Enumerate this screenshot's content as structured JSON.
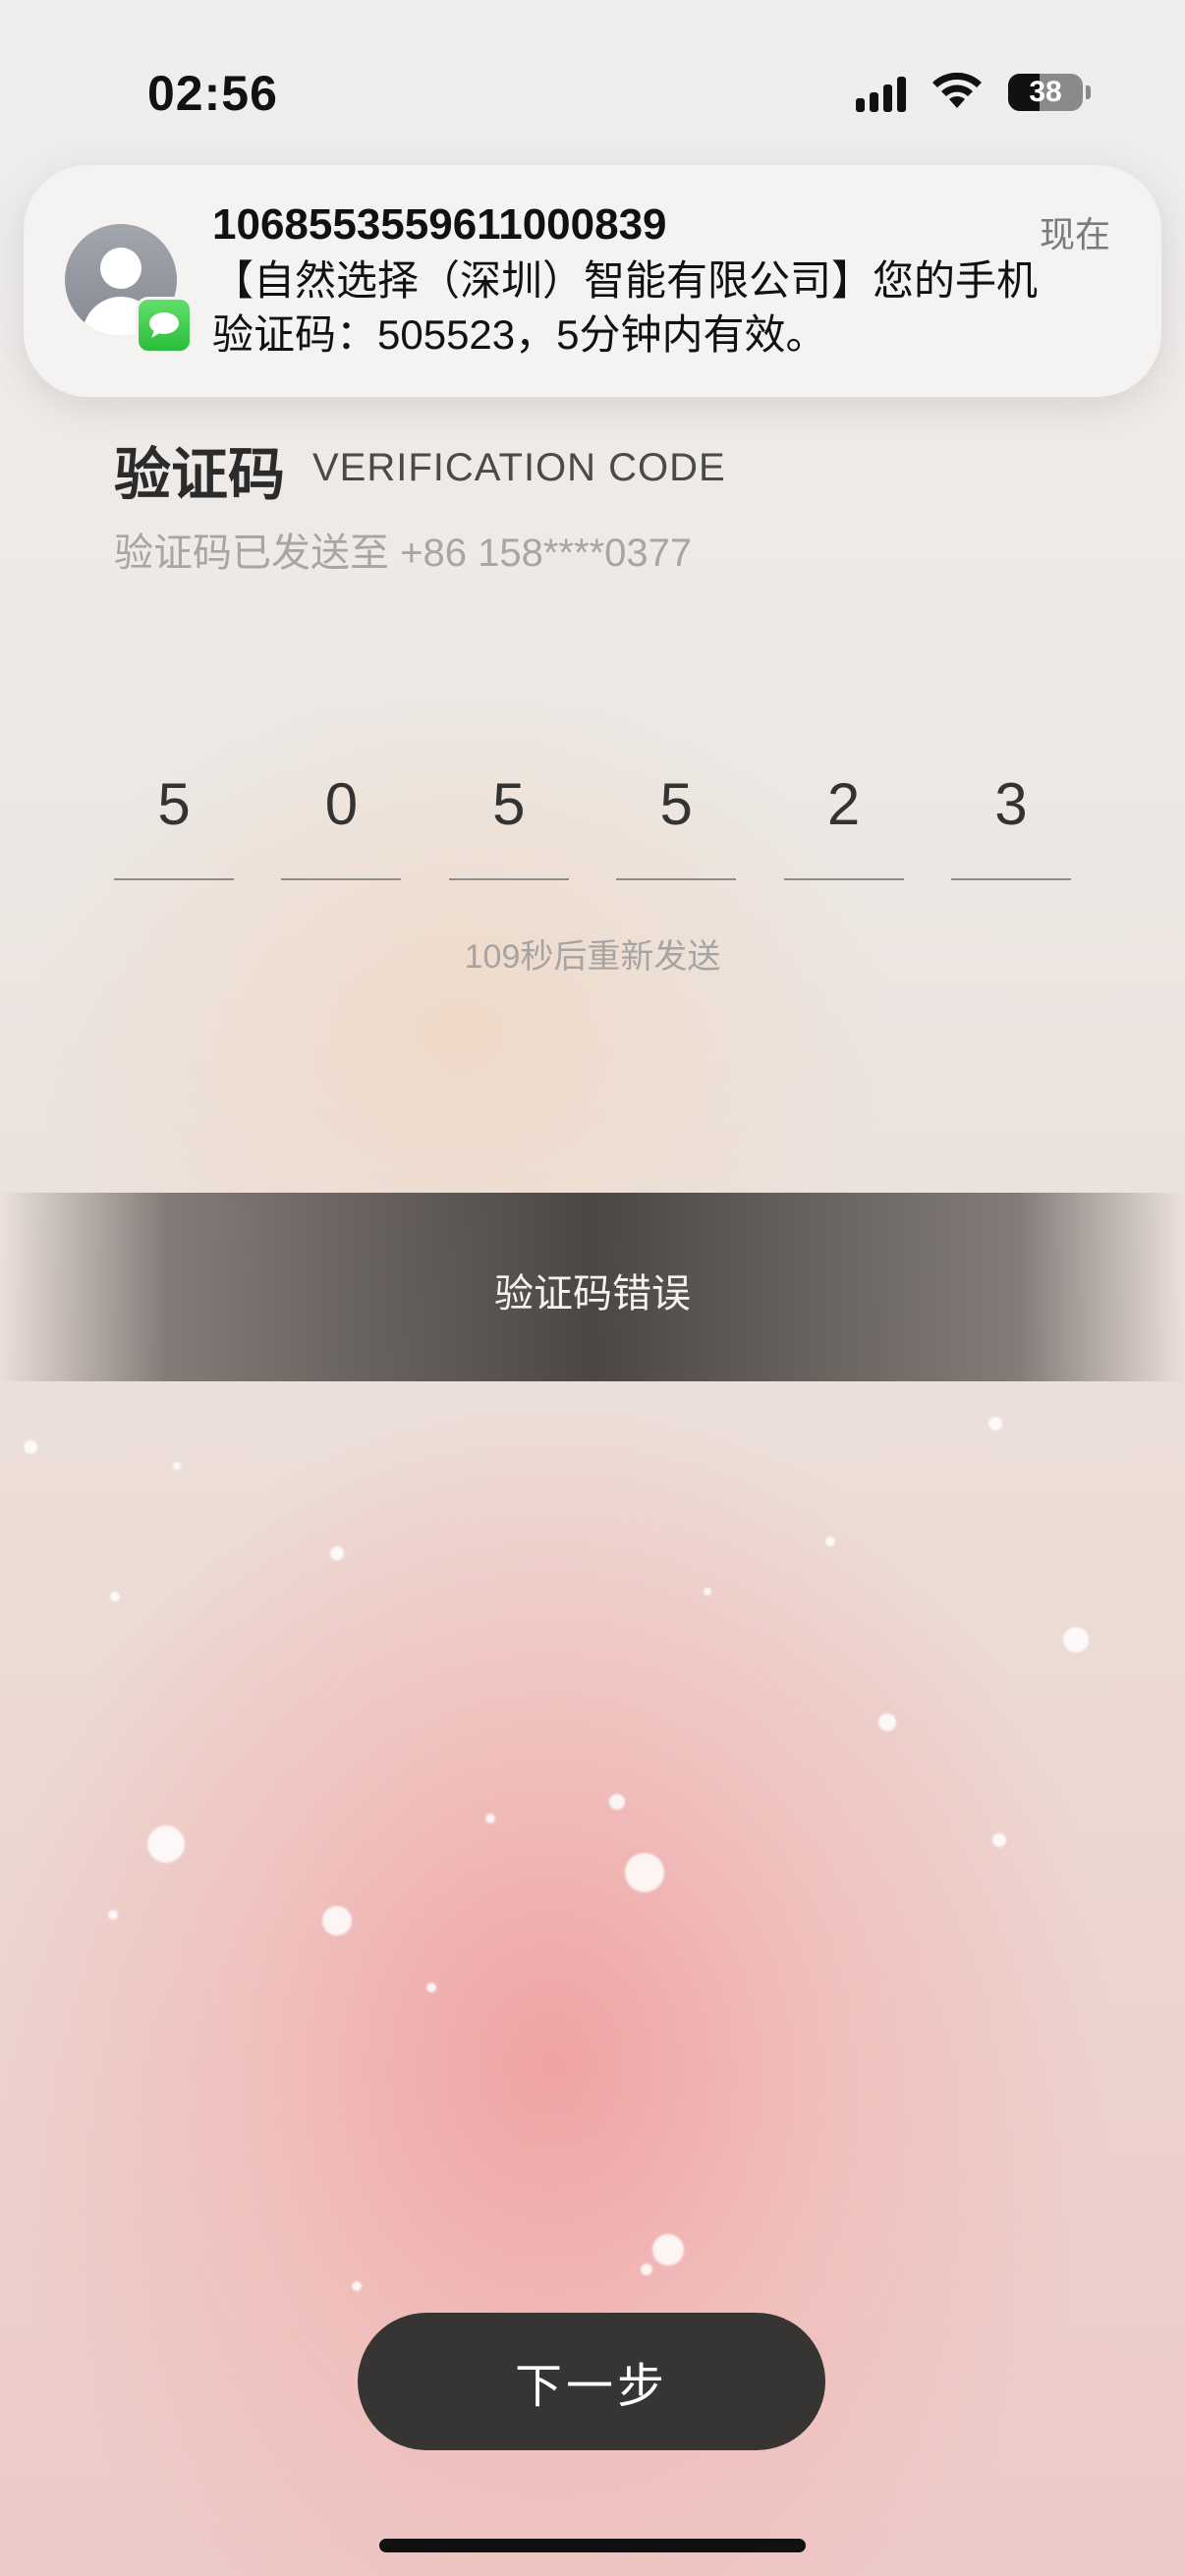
{
  "status_bar": {
    "time": "02:56",
    "battery_level": "38",
    "icons": [
      "cellular-signal-icon",
      "wifi-icon",
      "battery-icon"
    ]
  },
  "notification": {
    "sender": "1068553559611000839",
    "time": "现在",
    "message": "【自然选择（深圳）智能有限公司】您的手机验证码：505523，5分钟内有效。",
    "app_icon": "messages-icon",
    "avatar_icon": "contact-avatar-icon"
  },
  "page": {
    "title": "验证码",
    "title_en": "VERIFICATION CODE",
    "sent_to": "验证码已发送至 +86 158****0377"
  },
  "code": {
    "digits": [
      "5",
      "0",
      "5",
      "5",
      "2",
      "3"
    ]
  },
  "resend_text": "109秒后重新发送",
  "toast": {
    "message": "验证码错误"
  },
  "next_button": {
    "label": "下一步"
  },
  "colors": {
    "button_bg": "#363533",
    "toast_bg": "#3e3a38",
    "accent_green": "#2bbd3b"
  }
}
